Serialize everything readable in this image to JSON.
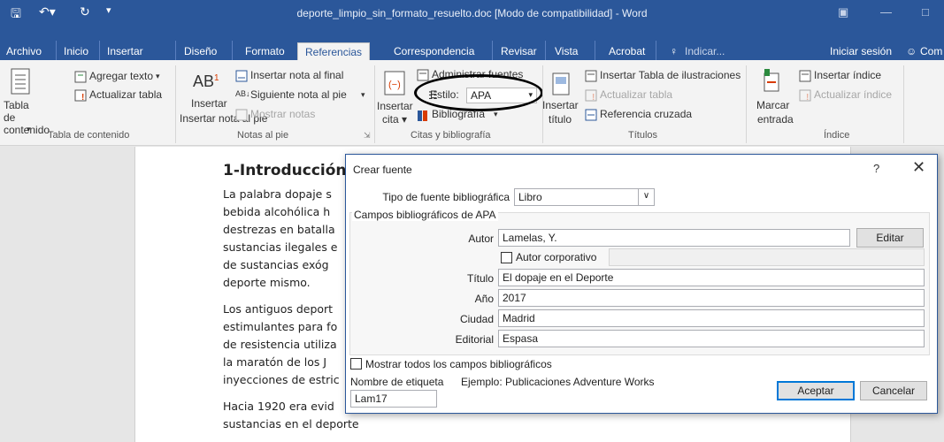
{
  "window": {
    "title": "deporte_limpio_sin_formato_resuelto.doc [Modo de compatibilidad] - Word"
  },
  "tabs": [
    "Archivo",
    "Inicio",
    "Insertar",
    "Diseño",
    "Formato",
    "Referencias",
    "Correspondencia",
    "Revisar",
    "Vista",
    "Acrobat"
  ],
  "tell_me": "Indicar...",
  "signin": "Iniciar sesión",
  "share": "Com",
  "ribbon": {
    "toc": {
      "button": "Tabla de contenido",
      "add_text": "Agregar texto",
      "update_table": "Actualizar tabla",
      "group": "Tabla de contenido"
    },
    "footnotes": {
      "insert_footnote": "Insertar nota al pie",
      "insert_endnote": "Insertar nota al final",
      "next_footnote": "Siguiente nota al pie",
      "show_notes": "Mostrar notas",
      "group": "Notas al pie"
    },
    "citations": {
      "insert_citation": "Insertar cita",
      "manage_sources": "Administrar fuentes",
      "style_label": "Estilo:",
      "style_value": "APA",
      "bibliography": "Bibliografía",
      "group": "Citas y bibliografía"
    },
    "captions": {
      "insert_caption": "Insertar título",
      "insert_table_figures": "Insertar Tabla de ilustraciones",
      "update_table": "Actualizar tabla",
      "cross_reference": "Referencia cruzada",
      "group": "Títulos"
    },
    "index": {
      "mark_entry": "Marcar entrada",
      "insert_index": "Insertar índice",
      "update_index": "Actualizar índice",
      "group": "Índice"
    }
  },
  "document": {
    "heading": "1-Introducción",
    "lines": [
      "La palabra dopaje s",
      "bebida alcohólica h",
      "destrezas en batalla",
      "sustancias ilegales e",
      "de sustancias exóg",
      "deporte mismo.",
      "Los antiguos deport",
      "estimulantes para fo",
      "de resistencia utiliza",
      "la maratón de los J",
      "inyecciones de estric",
      "Hacia 1920 era evid",
      "sustancias en el deporte"
    ]
  },
  "dialog": {
    "title": "Crear fuente",
    "help": "?",
    "close": "✕",
    "source_type_label": "Tipo de fuente bibliográfica",
    "source_type_value": "Libro",
    "fields_group": "Campos bibliográficos de APA",
    "author_label": "Autor",
    "author_value": "Lamelas, Y.",
    "edit_button": "Editar",
    "corporate_author": "Autor corporativo",
    "title_label": "Título",
    "title_value": "El dopaje en el Deporte",
    "year_label": "Año",
    "year_value": "2017",
    "city_label": "Ciudad",
    "city_value": "Madrid",
    "publisher_label": "Editorial",
    "publisher_value": "Espasa",
    "show_all": "Mostrar todos los campos bibliográficos",
    "tag_label": "Nombre de etiqueta",
    "tag_value": "Lam17",
    "example": "Ejemplo: Publicaciones Adventure Works",
    "ok": "Aceptar",
    "cancel": "Cancelar"
  },
  "colors": {
    "brand": "#2b579a",
    "ribbon": "#f3f3f3",
    "accent_button": "#0078d7"
  }
}
